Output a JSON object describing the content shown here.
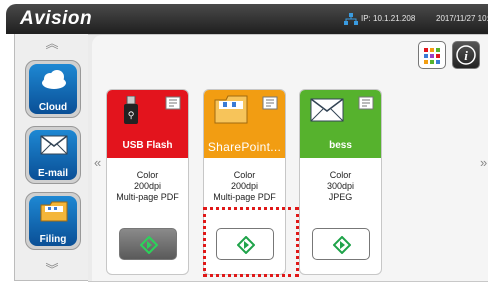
{
  "header": {
    "brand": "Avision",
    "ip": "IP: 10.1.21.208",
    "datetime": "2017/11/27 10:1"
  },
  "sidebar": {
    "items": [
      {
        "label": "Cloud",
        "icon": "cloud-icon"
      },
      {
        "label": "E-mail",
        "icon": "envelope-icon"
      },
      {
        "label": "Filing",
        "icon": "folder-icon"
      }
    ]
  },
  "main": {
    "left_arrow": "«",
    "right_arrow": "»",
    "cards": [
      {
        "name": "USB Flash",
        "line1": "Color",
        "line2": "200dpi",
        "line3": "Multi-page PDF",
        "color": "#e3141d",
        "icon": "usb-drive-icon"
      },
      {
        "name": "SharePoint...",
        "line1": "Color",
        "line2": "200dpi",
        "line3": "Multi-page PDF",
        "color": "#f29d12",
        "icon": "folder-icon"
      },
      {
        "name": "bess",
        "line1": "Color",
        "line2": "300dpi",
        "line3": "JPEG",
        "color": "#56b22d",
        "icon": "envelope-icon"
      }
    ]
  },
  "colors": {
    "accent_blue": "#0a64b8",
    "highlight_red": "#e01818",
    "scan_green": "#1fa34a"
  }
}
